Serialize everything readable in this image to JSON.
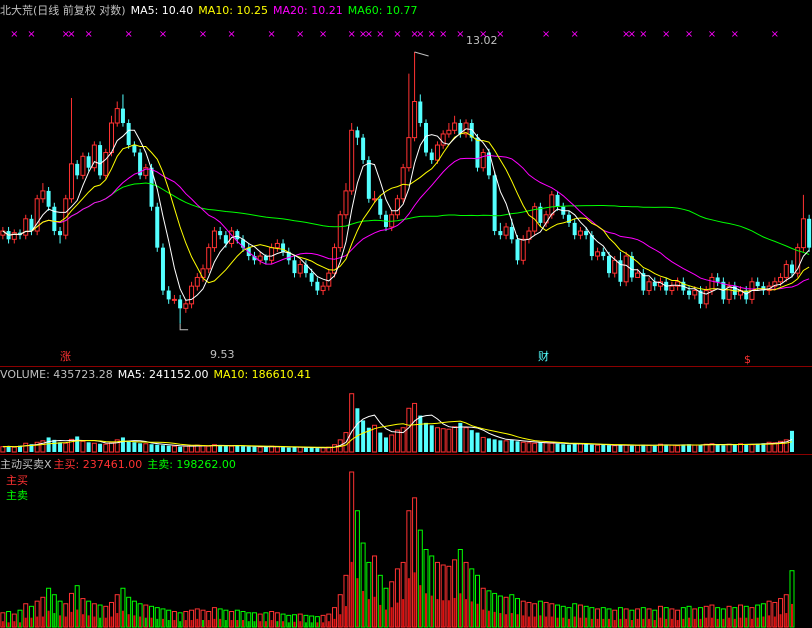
{
  "colors": {
    "up": "#ff3232",
    "down": "#54ffff",
    "ma5": "#ffffff",
    "ma10": "#ffff00",
    "ma20": "#ff00ff",
    "ma60": "#00ff00",
    "sell_bar": "#1f9a1f",
    "buy_bar": "#ff4a10",
    "grid": "#8b0000",
    "label": "#c0c0c0"
  },
  "price_panel": {
    "title": "北大荒(日线 前复权 对数)",
    "ma5": "MA5: 10.40",
    "ma10": "MA10: 10.25",
    "ma20": "MA20: 10.21",
    "ma60": "MA60: 10.77",
    "high_label": "13.02",
    "low_label": "9.53",
    "markers": [
      "涨",
      "财",
      "$"
    ]
  },
  "volume_panel": {
    "volume": "VOLUME: 435723.28",
    "ma5": "MA5: 241152.00",
    "ma10": "MA10: 186610.41"
  },
  "flow_panel": {
    "title": "主动买卖X",
    "buy": "主买: 237461.00",
    "sell": "主卖: 198262.00",
    "legend_buy": "主买",
    "legend_sell": "主卖"
  },
  "chart_data": [
    {
      "type": "candlestick",
      "title": "北大荒(日线 前复权 对数)",
      "scale": "log",
      "ylim": [
        9.3,
        13.2
      ],
      "annotations": {
        "max": 13.02,
        "min": 9.53
      },
      "ma_latest": {
        "MA5": 10.4,
        "MA10": 10.25,
        "MA20": 10.21,
        "MA60": 10.77
      },
      "x": [
        1,
        2,
        3,
        4,
        5,
        6,
        7,
        8,
        9,
        10,
        11,
        12,
        13,
        14,
        15,
        16,
        17,
        18,
        19,
        20,
        21,
        22,
        23,
        24,
        25,
        26,
        27,
        28,
        29,
        30,
        31,
        32,
        33,
        34,
        35,
        36,
        37,
        38,
        39,
        40,
        41,
        42,
        43,
        44,
        45,
        46,
        47,
        48,
        49,
        50,
        51,
        52,
        53,
        54,
        55,
        56,
        57,
        58,
        59,
        60,
        61,
        62,
        63,
        64,
        65,
        66,
        67,
        68,
        69,
        70,
        71,
        72,
        73,
        74,
        75,
        76,
        77,
        78,
        79,
        80,
        81,
        82,
        83,
        84,
        85,
        86,
        87,
        88,
        89,
        90,
        91,
        92,
        93,
        94,
        95,
        96,
        97,
        98,
        99,
        100,
        101,
        102,
        103,
        104,
        105,
        106,
        107,
        108,
        109,
        110,
        111,
        112,
        113,
        114,
        115,
        116,
        117,
        118,
        119,
        120,
        121,
        122,
        123,
        124,
        125,
        126,
        127,
        128,
        129,
        130,
        131,
        132,
        133,
        134,
        135,
        136,
        137,
        138,
        139,
        140,
        141,
        142
      ],
      "open": [
        10.55,
        10.6,
        10.5,
        10.58,
        10.55,
        10.75,
        10.6,
        11.0,
        11.1,
        10.9,
        10.6,
        10.55,
        11.0,
        11.45,
        11.3,
        11.55,
        11.4,
        11.7,
        11.3,
        11.6,
        12.0,
        12.2,
        12.0,
        11.7,
        11.6,
        11.3,
        11.4,
        10.9,
        10.4,
        9.9,
        9.8,
        9.8,
        9.7,
        9.75,
        9.95,
        10.05,
        10.15,
        10.4,
        10.6,
        10.55,
        10.45,
        10.6,
        10.5,
        10.4,
        10.3,
        10.25,
        10.3,
        10.25,
        10.4,
        10.45,
        10.35,
        10.25,
        10.1,
        10.2,
        10.1,
        10.0,
        9.9,
        9.95,
        10.1,
        10.4,
        10.8,
        11.1,
        11.9,
        11.8,
        11.5,
        11.0,
        11.0,
        10.8,
        10.65,
        10.8,
        11.0,
        11.4,
        11.8,
        12.3,
        12.0,
        11.6,
        11.5,
        11.7,
        11.85,
        11.9,
        12.0,
        11.85,
        12.0,
        11.8,
        11.4,
        11.6,
        11.3,
        10.6,
        10.55,
        10.65,
        10.5,
        10.25,
        10.5,
        10.6,
        10.9,
        10.7,
        10.8,
        11.05,
        10.9,
        10.8,
        10.7,
        10.55,
        10.6,
        10.55,
        10.3,
        10.35,
        10.3,
        10.1,
        10.25,
        10.0,
        10.3,
        10.05,
        10.1,
        9.9,
        10.0,
        9.95,
        10.0,
        9.9,
        9.95,
        10.0,
        9.9,
        9.85,
        9.9,
        9.75,
        9.9,
        10.05,
        10.0,
        9.8,
        9.95,
        9.85,
        9.9,
        9.8,
        10.0,
        9.95,
        9.9,
        9.95,
        10.0,
        10.05,
        10.2,
        10.1,
        10.4,
        10.75
      ],
      "close": [
        10.6,
        10.5,
        10.58,
        10.55,
        10.75,
        10.6,
        11.0,
        11.1,
        10.9,
        10.6,
        10.55,
        11.0,
        11.45,
        11.3,
        11.55,
        11.4,
        11.7,
        11.3,
        11.6,
        12.0,
        12.2,
        12.0,
        11.7,
        11.6,
        11.3,
        11.4,
        10.9,
        10.4,
        9.9,
        9.8,
        9.8,
        9.7,
        9.75,
        9.95,
        10.05,
        10.15,
        10.4,
        10.6,
        10.55,
        10.45,
        10.6,
        10.5,
        10.4,
        10.3,
        10.25,
        10.3,
        10.25,
        10.4,
        10.45,
        10.35,
        10.25,
        10.1,
        10.2,
        10.1,
        10.0,
        9.9,
        9.95,
        10.1,
        10.4,
        10.8,
        11.1,
        11.9,
        11.8,
        11.5,
        11.0,
        11.0,
        10.8,
        10.65,
        10.8,
        11.0,
        11.4,
        11.8,
        12.3,
        12.0,
        11.6,
        11.5,
        11.7,
        11.85,
        11.9,
        12.0,
        11.85,
        12.0,
        11.8,
        11.4,
        11.6,
        11.3,
        10.6,
        10.55,
        10.65,
        10.5,
        10.25,
        10.5,
        10.6,
        10.9,
        10.7,
        10.8,
        11.05,
        10.9,
        10.8,
        10.7,
        10.55,
        10.6,
        10.55,
        10.3,
        10.35,
        10.3,
        10.1,
        10.25,
        10.0,
        10.3,
        10.05,
        10.1,
        9.9,
        10.0,
        9.95,
        10.0,
        9.9,
        9.95,
        10.0,
        9.9,
        9.85,
        9.9,
        9.75,
        9.9,
        10.05,
        10.0,
        9.8,
        9.95,
        9.85,
        9.9,
        9.8,
        10.0,
        9.95,
        9.9,
        9.95,
        10.0,
        10.05,
        10.2,
        10.1,
        10.4,
        10.75,
        10.4
      ],
      "high": [
        10.65,
        10.65,
        10.62,
        10.62,
        10.8,
        10.8,
        11.05,
        11.2,
        11.15,
        10.95,
        10.65,
        11.05,
        12.35,
        11.5,
        11.6,
        11.6,
        11.75,
        11.75,
        11.65,
        12.1,
        12.3,
        12.4,
        12.05,
        11.75,
        11.65,
        11.45,
        11.45,
        10.95,
        10.45,
        9.95,
        9.85,
        9.85,
        9.8,
        10.0,
        10.1,
        10.2,
        10.45,
        10.65,
        10.65,
        10.6,
        10.65,
        10.62,
        10.55,
        10.45,
        10.35,
        10.35,
        10.32,
        10.45,
        10.5,
        10.5,
        10.4,
        10.3,
        10.25,
        10.25,
        10.15,
        10.05,
        10.0,
        10.15,
        10.45,
        10.85,
        11.2,
        12.0,
        11.95,
        11.85,
        11.55,
        11.1,
        11.05,
        10.85,
        10.85,
        11.05,
        11.45,
        12.7,
        13.02,
        12.4,
        12.05,
        11.65,
        11.75,
        11.9,
        12.0,
        12.1,
        12.05,
        12.05,
        12.05,
        11.85,
        11.65,
        11.65,
        11.35,
        10.7,
        10.7,
        10.75,
        10.55,
        10.55,
        10.65,
        10.95,
        10.95,
        10.85,
        11.1,
        11.1,
        10.95,
        10.85,
        10.75,
        10.65,
        10.65,
        10.6,
        10.4,
        10.4,
        10.35,
        10.3,
        10.35,
        10.35,
        10.35,
        10.15,
        10.15,
        10.05,
        10.05,
        10.05,
        10.05,
        10.0,
        10.05,
        10.05,
        9.95,
        9.95,
        9.95,
        9.95,
        10.1,
        10.1,
        10.05,
        10.0,
        10.0,
        9.95,
        9.95,
        10.05,
        10.05,
        10.0,
        10.0,
        10.05,
        10.1,
        10.25,
        10.25,
        10.45,
        11.05,
        10.8
      ],
      "low": [
        10.5,
        10.45,
        10.45,
        10.5,
        10.5,
        10.55,
        10.55,
        10.95,
        10.85,
        10.55,
        10.45,
        10.5,
        10.95,
        11.25,
        11.25,
        11.35,
        11.35,
        11.25,
        11.25,
        11.55,
        11.95,
        11.95,
        11.65,
        11.55,
        11.25,
        11.25,
        10.85,
        10.35,
        9.85,
        9.75,
        9.75,
        9.53,
        9.65,
        9.7,
        9.9,
        10.0,
        10.1,
        10.35,
        10.5,
        10.4,
        10.4,
        10.45,
        10.35,
        10.25,
        10.2,
        10.2,
        10.2,
        10.2,
        10.35,
        10.3,
        10.2,
        10.05,
        10.05,
        10.05,
        9.95,
        9.85,
        9.85,
        9.9,
        10.05,
        10.35,
        10.75,
        11.05,
        11.7,
        11.45,
        10.95,
        10.95,
        10.75,
        10.6,
        10.6,
        10.75,
        10.95,
        11.35,
        11.75,
        11.95,
        11.55,
        11.45,
        11.45,
        11.65,
        11.8,
        11.85,
        11.8,
        11.8,
        11.75,
        11.35,
        11.35,
        11.25,
        10.55,
        10.5,
        10.5,
        10.45,
        10.2,
        10.2,
        10.45,
        10.55,
        10.65,
        10.65,
        10.75,
        10.85,
        10.75,
        10.65,
        10.5,
        10.5,
        10.5,
        10.25,
        10.25,
        10.25,
        10.05,
        10.05,
        9.95,
        9.95,
        10.0,
        10.05,
        9.85,
        9.85,
        9.9,
        9.9,
        9.85,
        9.85,
        9.9,
        9.85,
        9.8,
        9.8,
        9.7,
        9.7,
        9.85,
        9.95,
        9.75,
        9.75,
        9.8,
        9.8,
        9.75,
        9.75,
        9.9,
        9.85,
        9.85,
        9.9,
        9.95,
        10.0,
        10.05,
        10.05,
        10.35,
        10.35
      ]
    },
    {
      "type": "bar",
      "title": "VOLUME",
      "latest": {
        "VOLUME": 435723.28,
        "MA5": 241152.0,
        "MA10": 186610.41
      },
      "ylim": [
        0,
        1400000
      ],
      "values": [
        110000,
        120000,
        100000,
        130000,
        180000,
        160000,
        200000,
        230000,
        300000,
        250000,
        200000,
        180000,
        260000,
        320000,
        220000,
        200000,
        180000,
        170000,
        160000,
        190000,
        250000,
        300000,
        230000,
        200000,
        180000,
        170000,
        160000,
        150000,
        140000,
        130000,
        120000,
        110000,
        120000,
        130000,
        140000,
        130000,
        120000,
        150000,
        140000,
        130000,
        120000,
        130000,
        120000,
        110000,
        110000,
        100000,
        110000,
        120000,
        110000,
        100000,
        90000,
        95000,
        100000,
        90000,
        85000,
        80000,
        90000,
        100000,
        150000,
        250000,
        400000,
        1200000,
        900000,
        650000,
        500000,
        550000,
        400000,
        300000,
        350000,
        450000,
        500000,
        900000,
        1000000,
        750000,
        600000,
        550000,
        500000,
        480000,
        470000,
        520000,
        600000,
        500000,
        450000,
        400000,
        300000,
        280000,
        260000,
        240000,
        230000,
        250000,
        220000,
        200000,
        190000,
        180000,
        200000,
        190000,
        180000,
        170000,
        160000,
        150000,
        180000,
        170000,
        160000,
        150000,
        140000,
        150000,
        140000,
        130000,
        150000,
        140000,
        130000,
        140000,
        150000,
        140000,
        130000,
        160000,
        150000,
        140000,
        130000,
        150000,
        160000,
        140000,
        150000,
        160000,
        170000,
        150000,
        140000,
        160000,
        150000,
        170000,
        160000,
        150000,
        170000,
        180000,
        200000,
        190000,
        220000,
        250000,
        435723
      ]
    },
    {
      "type": "bar",
      "title": "主动买卖X",
      "latest": {
        "主买": 237461.0,
        "主卖": 198262.0
      },
      "series": [
        {
          "name": "主买",
          "values": [
            60000,
            80000,
            50000,
            90000,
            100000,
            80000,
            110000,
            140000,
            160000,
            120000,
            100000,
            90000,
            130000,
            170000,
            110000,
            100000,
            90000,
            80000,
            80000,
            100000,
            130000,
            160000,
            120000,
            100000,
            90000,
            80000,
            80000,
            70000,
            70000,
            60000,
            60000,
            50000,
            60000,
            70000,
            70000,
            60000,
            60000,
            80000,
            70000,
            60000,
            60000,
            70000,
            60000,
            50000,
            50000,
            50000,
            60000,
            60000,
            50000,
            50000,
            40000,
            50000,
            50000,
            40000,
            40000,
            40000,
            50000,
            50000,
            80000,
            140000,
            220000,
            640000,
            480000,
            340000,
            260000,
            290000,
            210000,
            150000,
            180000,
            240000,
            260000,
            480000,
            530000,
            390000,
            310000,
            280000,
            260000,
            250000,
            240000,
            270000,
            310000,
            260000,
            230000,
            200000,
            150000,
            140000,
            130000,
            120000,
            120000,
            130000,
            110000,
            100000,
            100000,
            90000,
            100000,
            100000,
            90000,
            90000,
            80000,
            80000,
            90000,
            90000,
            80000,
            80000,
            70000,
            80000,
            70000,
            70000,
            80000,
            70000,
            70000,
            70000,
            80000,
            70000,
            70000,
            80000,
            80000,
            70000,
            70000,
            80000,
            80000,
            70000,
            80000,
            80000,
            90000,
            80000,
            70000,
            80000,
            80000,
            90000,
            80000,
            80000,
            90000,
            90000,
            100000,
            100000,
            110000,
            130000,
            237461
          ]
        },
        {
          "name": "主卖",
          "values": [
            50000,
            40000,
            50000,
            40000,
            80000,
            80000,
            90000,
            90000,
            140000,
            130000,
            100000,
            90000,
            130000,
            150000,
            110000,
            100000,
            90000,
            90000,
            80000,
            90000,
            120000,
            140000,
            110000,
            100000,
            90000,
            90000,
            80000,
            80000,
            70000,
            70000,
            60000,
            60000,
            60000,
            60000,
            70000,
            70000,
            60000,
            70000,
            70000,
            70000,
            60000,
            60000,
            60000,
            60000,
            60000,
            50000,
            50000,
            60000,
            60000,
            50000,
            50000,
            45000,
            50000,
            50000,
            45000,
            40000,
            40000,
            50000,
            70000,
            110000,
            180000,
            560000,
            420000,
            310000,
            240000,
            260000,
            190000,
            150000,
            170000,
            210000,
            240000,
            420000,
            470000,
            360000,
            290000,
            270000,
            240000,
            230000,
            230000,
            250000,
            290000,
            240000,
            220000,
            200000,
            150000,
            140000,
            130000,
            120000,
            110000,
            120000,
            110000,
            100000,
            90000,
            90000,
            100000,
            90000,
            90000,
            80000,
            80000,
            70000,
            90000,
            80000,
            80000,
            70000,
            70000,
            70000,
            70000,
            60000,
            70000,
            70000,
            60000,
            70000,
            70000,
            70000,
            60000,
            80000,
            70000,
            70000,
            60000,
            70000,
            80000,
            70000,
            70000,
            80000,
            80000,
            70000,
            70000,
            80000,
            70000,
            80000,
            80000,
            70000,
            80000,
            90000,
            100000,
            90000,
            110000,
            120000,
            198262
          ]
        }
      ]
    }
  ]
}
